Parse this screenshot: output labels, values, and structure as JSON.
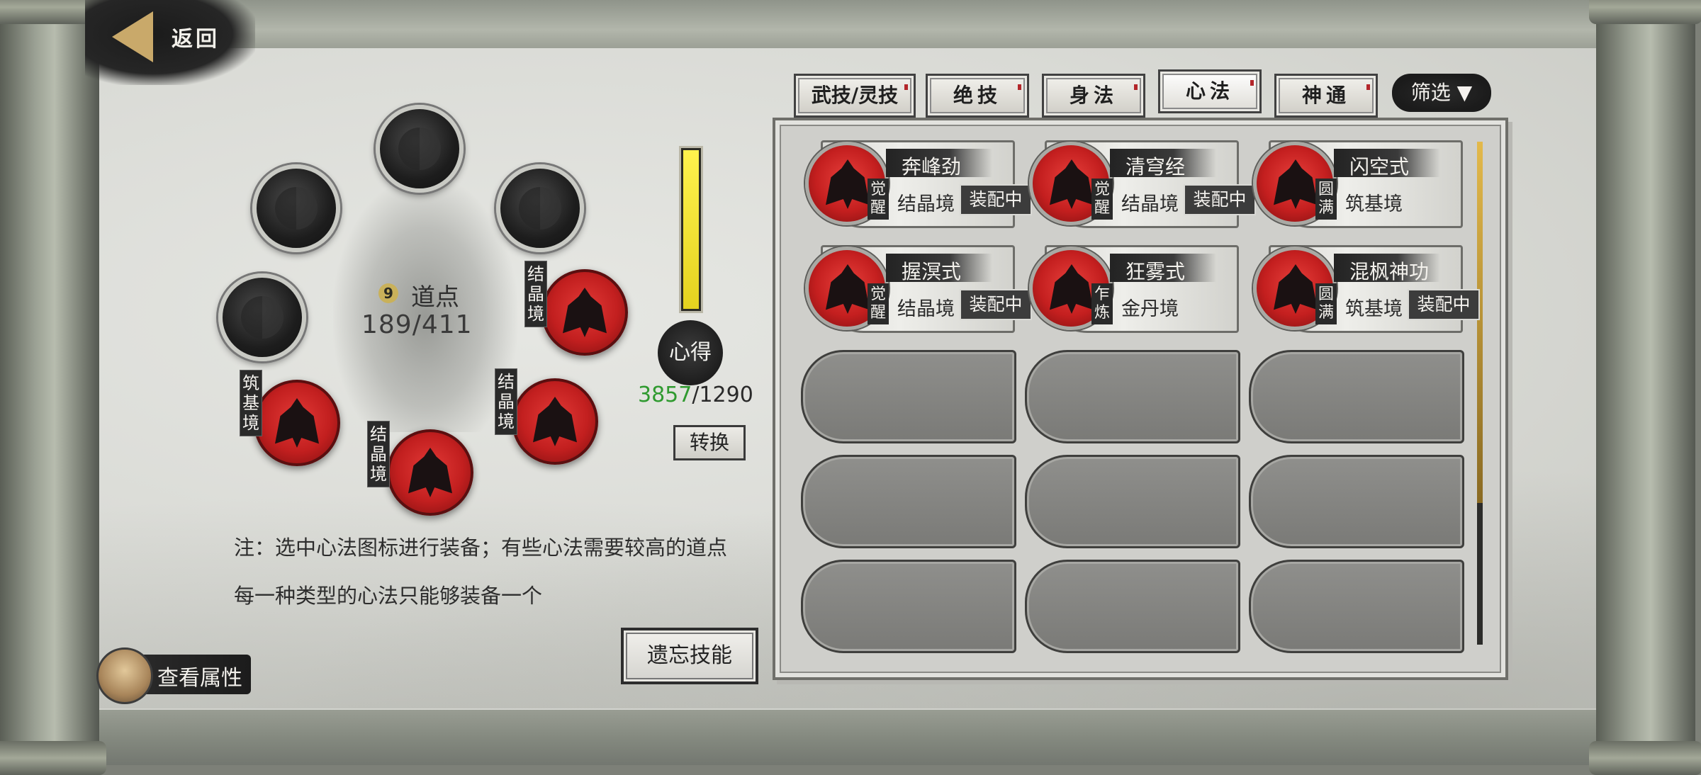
{
  "nav": {
    "back_label": "返回"
  },
  "orbit": {
    "dao_label": "道点",
    "dao_value": "189/411",
    "slots": [
      {
        "realm": ""
      },
      {
        "realm": ""
      },
      {
        "realm": ""
      },
      {
        "realm": ""
      },
      {
        "realm": "结晶境"
      },
      {
        "realm": "结晶境"
      },
      {
        "realm": "结晶境"
      },
      {
        "realm": "筑基境"
      }
    ]
  },
  "xinde": {
    "label": "心得",
    "current": "3857",
    "separator": "/",
    "max": "1290",
    "fill_fraction": 1.0,
    "convert_label": "转换"
  },
  "notes": [
    "注：选中心法图标进行装备；有些心法需要较高的道点",
    "每一种类型的心法只能够装备一个"
  ],
  "buttons": {
    "forget_label": "遗忘技能",
    "attributes_label": "查看属性",
    "filter_label": "筛选 ▼"
  },
  "tabs": [
    {
      "label": "武技/灵技",
      "active": false
    },
    {
      "label": "绝技",
      "active": false
    },
    {
      "label": "身法",
      "active": false
    },
    {
      "label": "心法",
      "active": true
    },
    {
      "label": "神通",
      "active": false
    }
  ],
  "skills": [
    {
      "name": "奔峰劲",
      "tag": "觉醒",
      "realm": "结晶境",
      "equipped": "装配中"
    },
    {
      "name": "清穹经",
      "tag": "觉醒",
      "realm": "结晶境",
      "equipped": "装配中"
    },
    {
      "name": "闪空式",
      "tag": "圆满",
      "realm": "筑基境",
      "equipped": ""
    },
    {
      "name": "握溟式",
      "tag": "觉醒",
      "realm": "结晶境",
      "equipped": "装配中"
    },
    {
      "name": "狂雾式",
      "tag": "乍炼",
      "realm": "金丹境",
      "equipped": ""
    },
    {
      "name": "混枫神功",
      "tag": "圆满",
      "realm": "筑基境",
      "equipped": "装配中"
    }
  ],
  "colors": {
    "accent_red": "#c41f1f",
    "xinde_green": "#2f9a2f",
    "bar_yellow": "#fff24d"
  }
}
